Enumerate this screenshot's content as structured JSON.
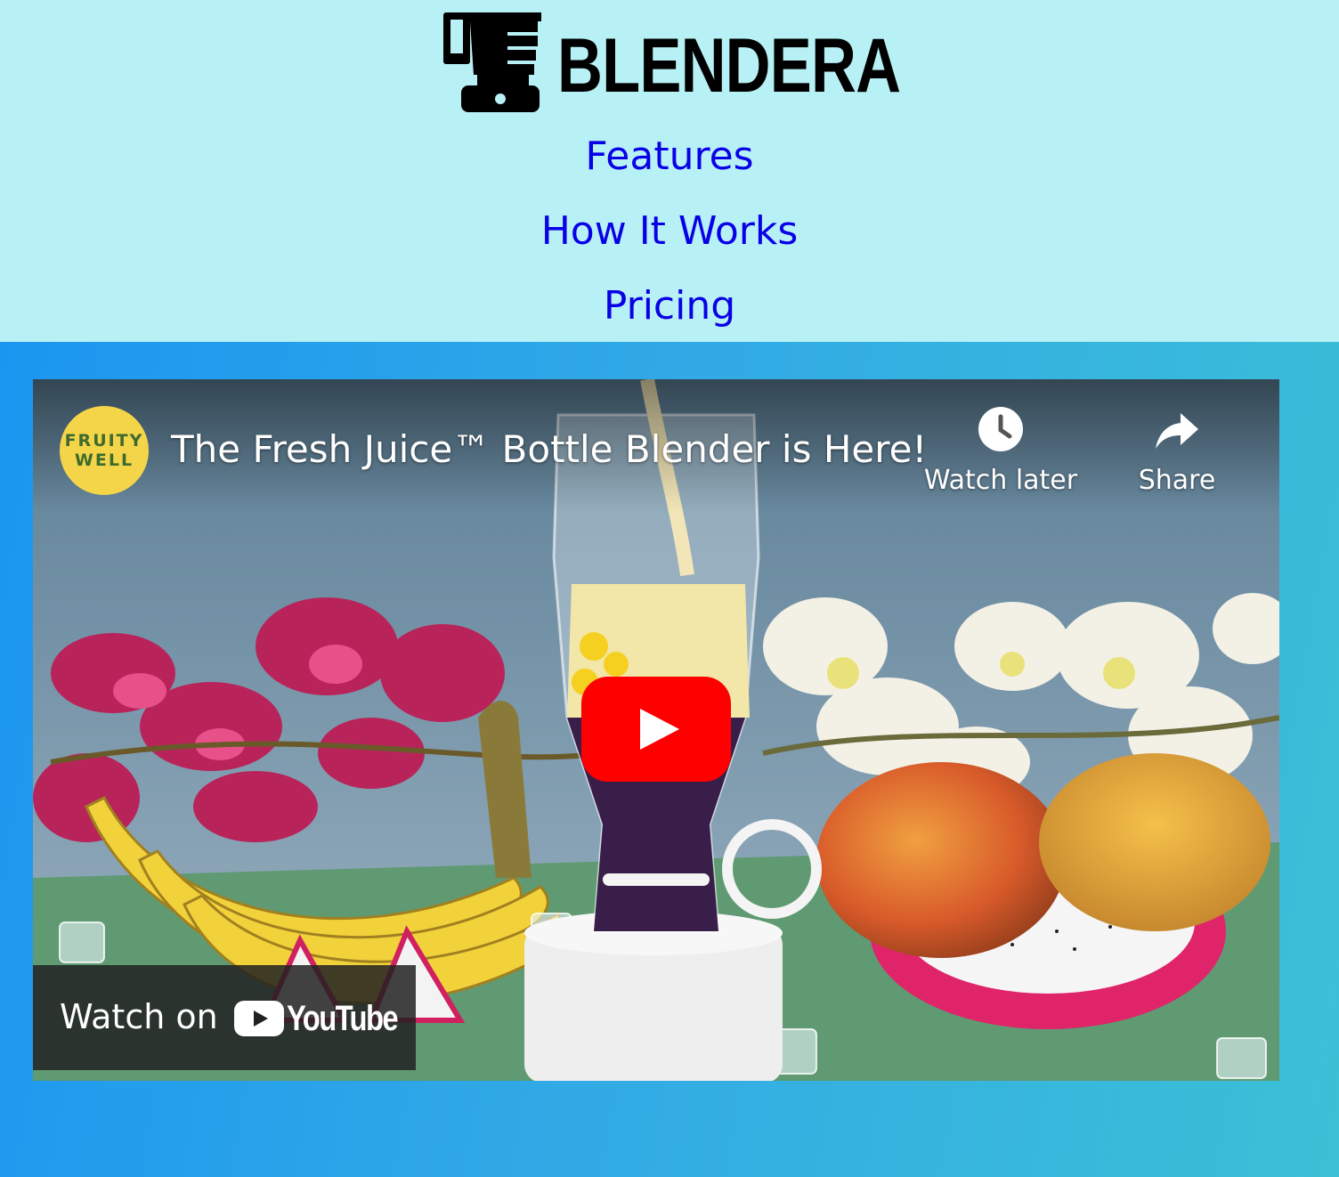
{
  "brand": {
    "name": "BLENDERA",
    "logo_icon": "blender-icon"
  },
  "nav": {
    "items": [
      "Features",
      "How It Works",
      "Pricing"
    ],
    "link_color": "#0a00e6"
  },
  "video": {
    "channel_avatar_text": [
      "FRUITY",
      "WELL"
    ],
    "title": "The Fresh Juice™ Bottle Blender is Here!",
    "watch_later_label": "Watch later",
    "share_label": "Share",
    "watch_on_label": "Watch on",
    "youtube_label": "YouTube",
    "play_color": "#ff0000"
  },
  "colors": {
    "header_bg": "#b7f1f6",
    "hero_bg_start": "#1b96f0",
    "hero_bg_end": "#3cc0d6"
  }
}
